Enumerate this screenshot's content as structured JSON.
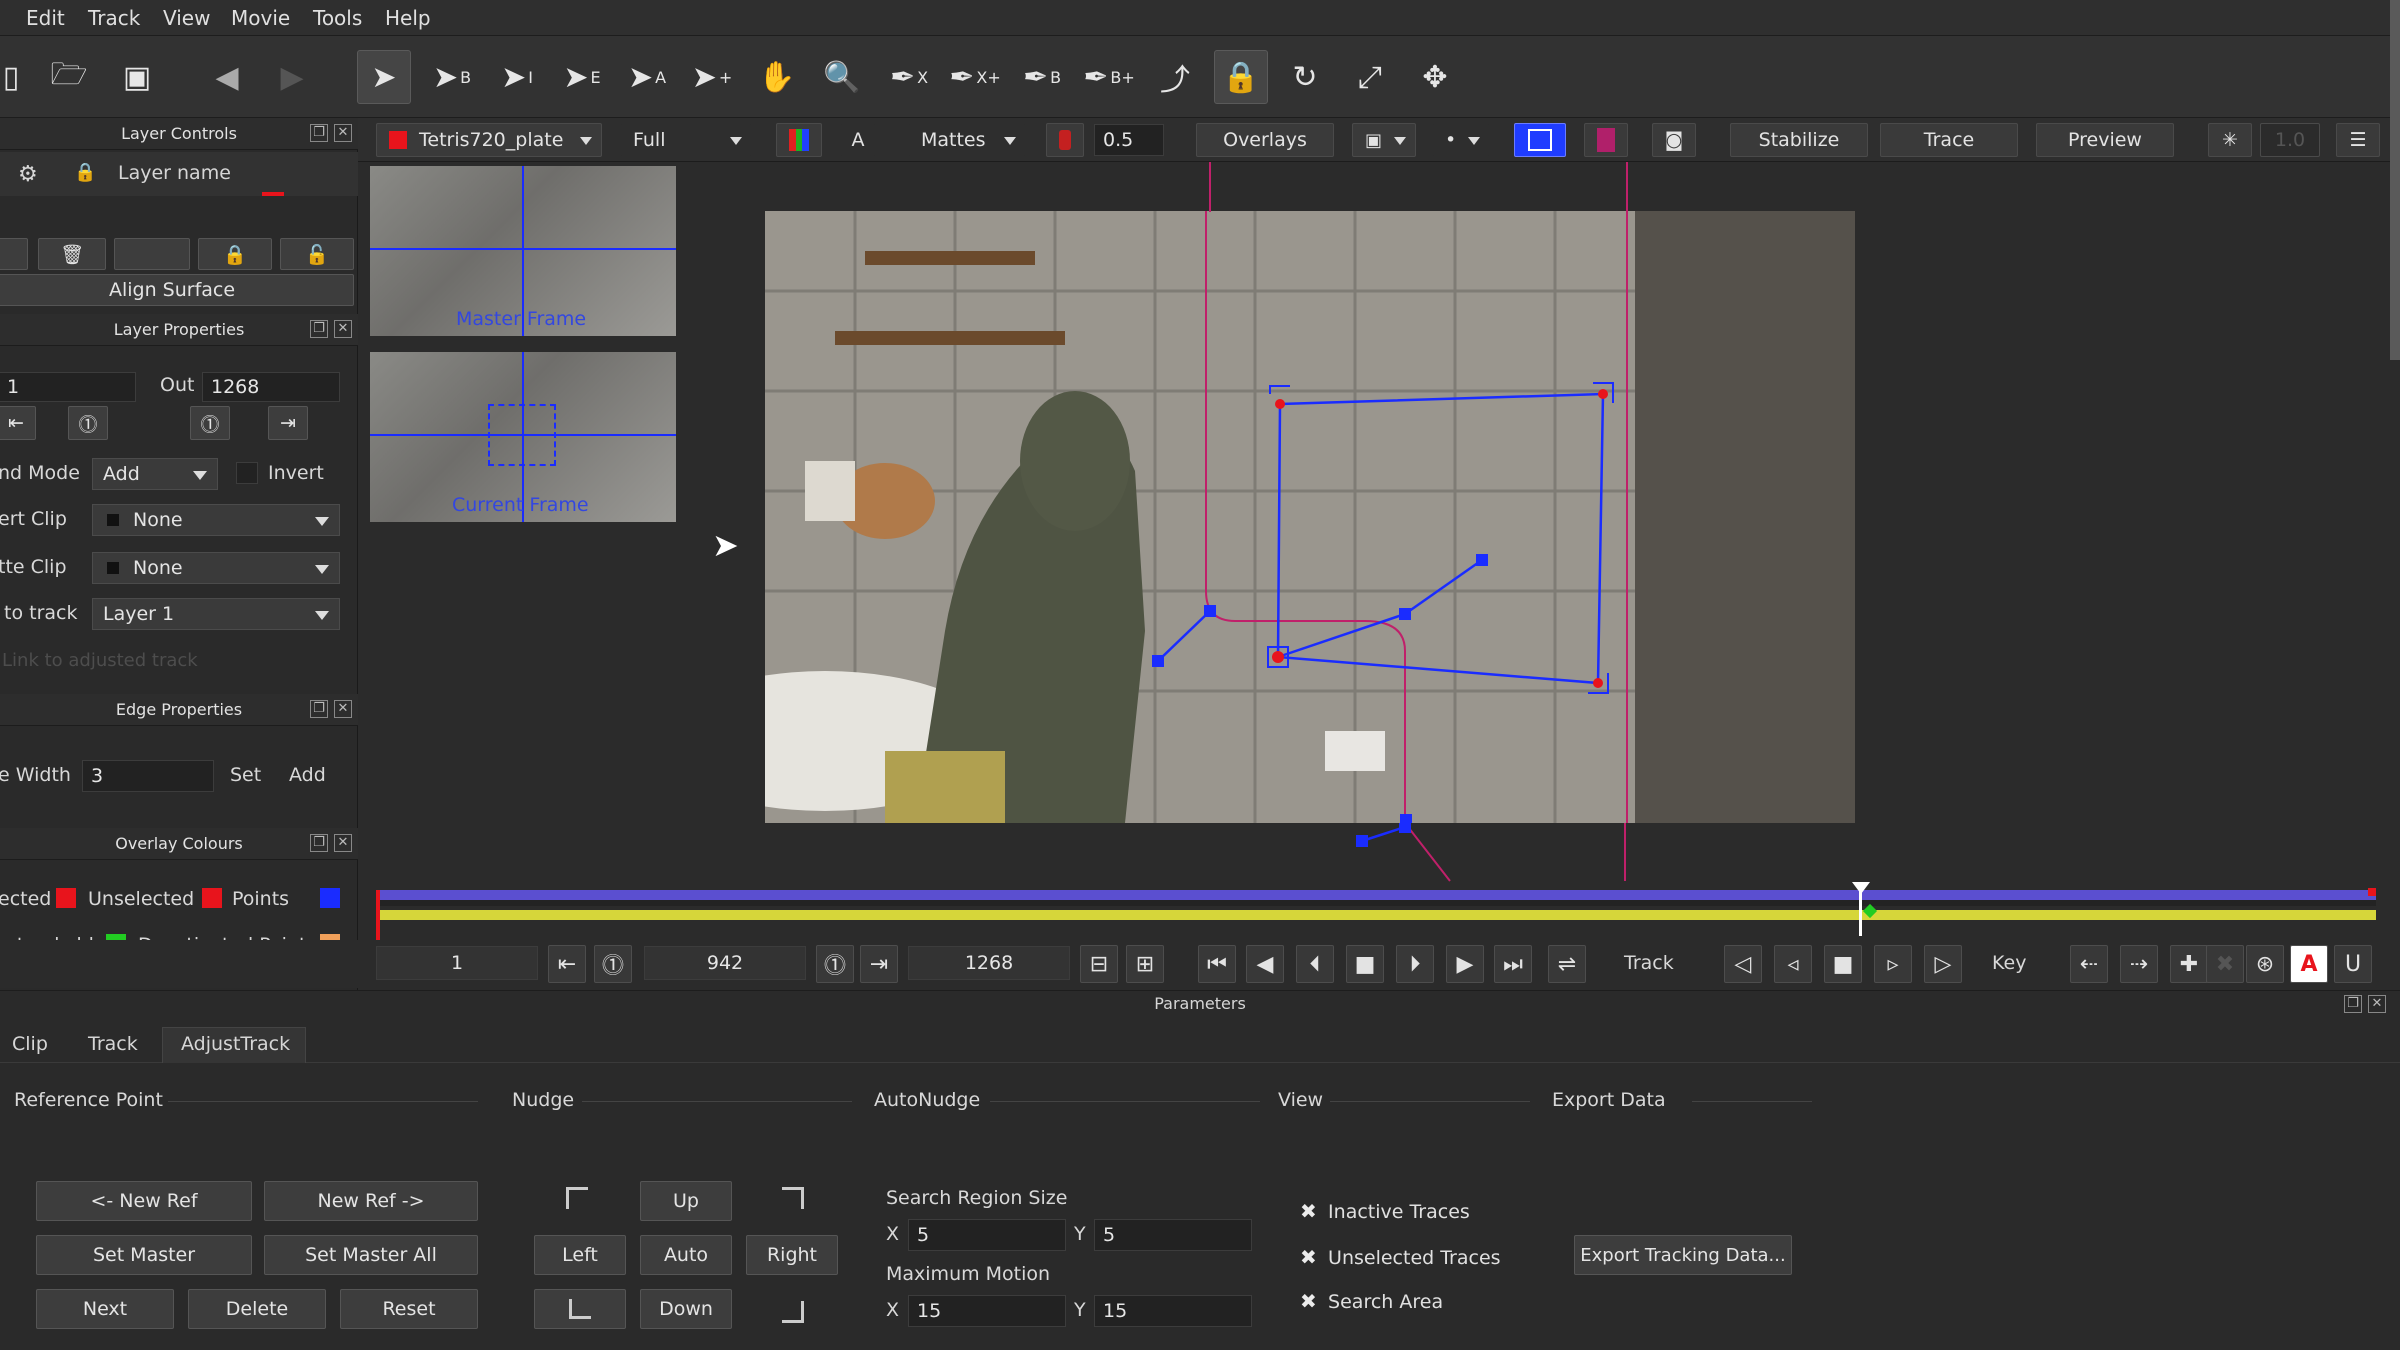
{
  "menu": [
    "Edit",
    "Track",
    "View",
    "Movie",
    "Tools",
    "Help"
  ],
  "toolbar": {
    "letters": {
      "b": "B",
      "i": "I",
      "e": "E",
      "a": "A",
      "x": "X",
      "xplus": "X+",
      "bpt": "B",
      "bplus": "B+"
    }
  },
  "viewbar": {
    "clip_name": "Tetris720_plate",
    "quality": "Full",
    "a_label": "A",
    "mattes": "Mattes",
    "opacity": "0.5",
    "overlays": "Overlays",
    "stabilize": "Stabilize",
    "trace": "Trace",
    "preview": "Preview",
    "zoom": "1.0"
  },
  "layer_controls": {
    "title": "Layer Controls",
    "layer_name_header": "Layer name",
    "align_surface": "Align Surface"
  },
  "layer_properties": {
    "title": "Layer Properties",
    "in_value": "1",
    "out_label": "Out",
    "out_value": "1268",
    "blend_mode_label": "nd Mode",
    "blend_mode": "Add",
    "invert": "Invert",
    "insert_clip_label": "ert Clip",
    "insert_clip": "None",
    "matte_clip_label": "tte Clip",
    "matte_clip": "None",
    "link_label": "to track",
    "link_value": "Layer 1",
    "link_adjusted": "Link to adjusted track"
  },
  "edge_properties": {
    "title": "Edge Properties",
    "width_label": "e Width",
    "width_value": "3",
    "set": "Set",
    "add": "Add"
  },
  "overlay_colours": {
    "title": "Overlay Colours",
    "selected": "ected",
    "unselected": "Unselected",
    "points": "Points",
    "non_trackable": "n-trackable",
    "deactivated": "Deactivated Points",
    "colors": {
      "selected": "#e8141c",
      "unselected": "#e8141c",
      "points": "#1a2cff",
      "non_trackable": "#e8141c",
      "deactivated": "#22cc22",
      "deactivated_points": "#f0a05a"
    }
  },
  "thumbs": {
    "master": "Master Frame",
    "current": "Current Frame"
  },
  "transport": {
    "start": "1",
    "current": "942",
    "end": "1268",
    "track": "Track",
    "key": "Key",
    "a": "A"
  },
  "params": {
    "title": "Parameters",
    "tabs": [
      "Clip",
      "Track",
      "AdjustTrack"
    ],
    "sections": {
      "ref": "Reference Point",
      "nudge": "Nudge",
      "autonudge": "AutoNudge",
      "view": "View",
      "export": "Export Data"
    },
    "ref_buttons": {
      "new_ref_back": "<- New Ref",
      "new_ref_fwd": "New Ref ->",
      "set_master": "Set Master",
      "set_master_all": "Set Master All",
      "next": "Next",
      "delete": "Delete",
      "reset": "Reset"
    },
    "nudge_buttons": {
      "up": "Up",
      "left": "Left",
      "auto": "Auto",
      "right": "Right",
      "down": "Down"
    },
    "search_region_label": "Search Region Size",
    "search_x": "5",
    "search_y": "5",
    "max_motion_label": "Maximum Motion",
    "motion_x": "15",
    "motion_y": "15",
    "x": "X",
    "y": "Y",
    "view_checks": [
      "Inactive Traces",
      "Unselected Traces",
      "Search Area"
    ],
    "export_button": "Export Tracking Data..."
  }
}
